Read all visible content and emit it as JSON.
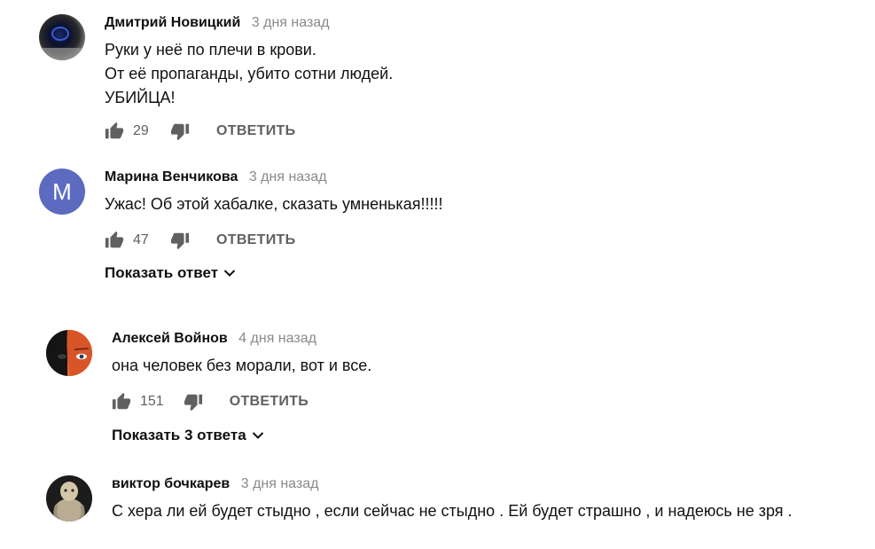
{
  "comments": [
    {
      "author": "Дмитрий Новицкий",
      "time": "3 дня назад",
      "lines": [
        "Руки  у неё по плечи в крови.",
        "От её пропаганды, убито сотни людей.",
        "УБИЙЦА!"
      ],
      "likes": "29",
      "reply_label": "ОТВЕТИТЬ"
    },
    {
      "author": "Марина Венчикова",
      "time": "3 дня назад",
      "avatar_letter": "М",
      "avatar_color": "#5c6bc0",
      "lines": [
        "Ужас! Об этой хабалке, сказать умненькая!!!!!"
      ],
      "likes": "47",
      "reply_label": "ОТВЕТИТЬ",
      "show_replies": "Показать ответ"
    },
    {
      "author": "Алексей Войнов",
      "time": "4 дня назад",
      "lines": [
        "она человек без морали, вот и все."
      ],
      "likes": "151",
      "reply_label": "ОТВЕТИТЬ",
      "show_replies": "Показать 3 ответа"
    },
    {
      "author": "виктор бочкарев",
      "time": "3 дня назад",
      "lines": [
        "С хера ли ей будет стыдно , если сейчас не стыдно . Ей будет страшно , и надеюсь не зря ."
      ]
    }
  ],
  "icons": {
    "like": "thumbs-up-icon",
    "dislike": "thumbs-down-icon",
    "expand": "chevron-down-icon"
  }
}
